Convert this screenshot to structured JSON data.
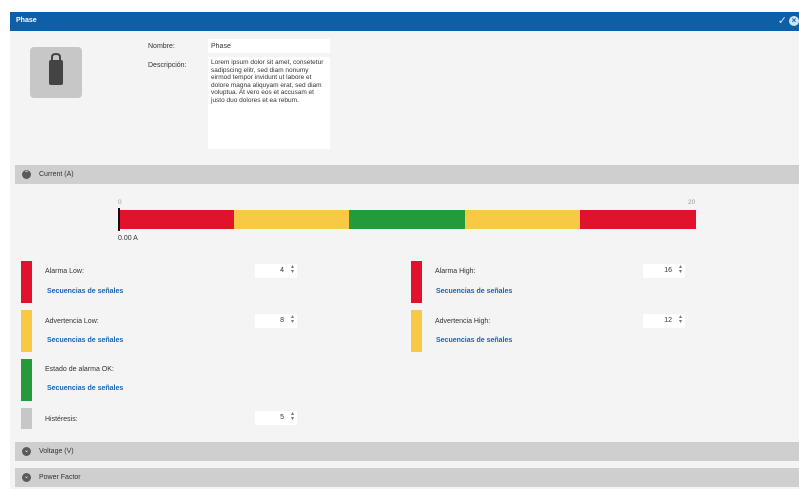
{
  "window": {
    "title": "Phase"
  },
  "form": {
    "name_label": "Nombre:",
    "name_value": "Phase",
    "desc_label": "Descripción:",
    "desc_value": "Lorem ipsum dolor sit amet, consetetur sadipscing elitr, sed diam nonumy eirmod tempor invidunt ut labore et dolore magna aliquyam erat, sed diam voluptua. At vero eos et accusam et justo duo dolores et ea rebum."
  },
  "sections": {
    "current": "Current (A)",
    "voltage": "Voltage (V)",
    "power_factor": "Power Factor"
  },
  "scale": {
    "min_label": "0",
    "max_label": "20",
    "min": 0,
    "max": 20,
    "current_value": 0,
    "current_text": "0.00 A",
    "segments": [
      "#e0122c",
      "#f8c945",
      "#259a3a",
      "#f8c945",
      "#e0122c"
    ]
  },
  "thresholds": {
    "alarm_low": {
      "label": "Alarma Low:",
      "value": "4",
      "link": "Secuencias de señales",
      "color": "#e0122c"
    },
    "alarm_high": {
      "label": "Alarma High:",
      "value": "16",
      "link": "Secuencias de señales",
      "color": "#e0122c"
    },
    "warn_low": {
      "label": "Advertencia Low:",
      "value": "8",
      "link": "Secuencias de señales",
      "color": "#f8c945"
    },
    "warn_high": {
      "label": "Advertencia High:",
      "value": "12",
      "link": "Secuencias de señales",
      "color": "#f8c945"
    },
    "ok": {
      "label": "Estado de alarma OK:",
      "link": "Secuencias de señales",
      "color": "#259a3a"
    },
    "hysteresis": {
      "label": "Histéresis:",
      "value": "5",
      "color": "#c7c7c7"
    }
  }
}
